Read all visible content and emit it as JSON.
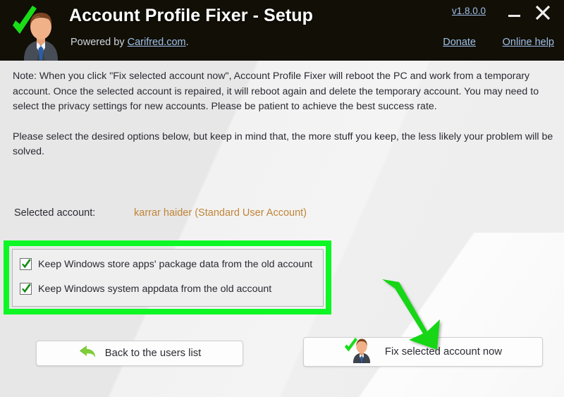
{
  "window": {
    "title": "Account Profile Fixer - Setup",
    "powered_prefix": "Powered by ",
    "powered_link": "Carifred.com",
    "powered_suffix": ".",
    "version": "v1.8.0.0",
    "donate": "Donate",
    "online_help": "Online help",
    "minimize_icon": "minimize-icon",
    "close_icon": "close-icon",
    "logo_icon": "user-check-icon",
    "header_bg": "#120f06",
    "link_color": "#9fc0e8"
  },
  "note": {
    "paragraph_1": "Note: When you click \"Fix selected account now\", Account Profile Fixer will reboot the PC and work from a temporary account. Once the selected account is repaired, it will reboot again and delete the temporary account. You may need to select the privacy settings for new accounts. Please be patient to achieve the best success rate.",
    "paragraph_2": "Please select the desired options below, but keep in mind that, the more stuff you keep, the less likely your problem will be solved."
  },
  "account": {
    "label": "Selected account:",
    "value": "karrar haider (Standard User Account)",
    "value_color": "#c08438"
  },
  "options": {
    "items": [
      {
        "label": "Keep Windows store apps' package data from the old account",
        "checked": true
      },
      {
        "label": "Keep Windows system appdata from the old account",
        "checked": true
      }
    ],
    "highlight_color": "#0df724"
  },
  "buttons": {
    "back": {
      "label": "Back to the users list",
      "icon": "undo-arrow-icon"
    },
    "fix": {
      "label": "Fix selected account now",
      "icon": "user-check-icon"
    }
  },
  "annotation": {
    "arrow_color": "#13d613",
    "arrow_name": "green-pointer-arrow"
  }
}
